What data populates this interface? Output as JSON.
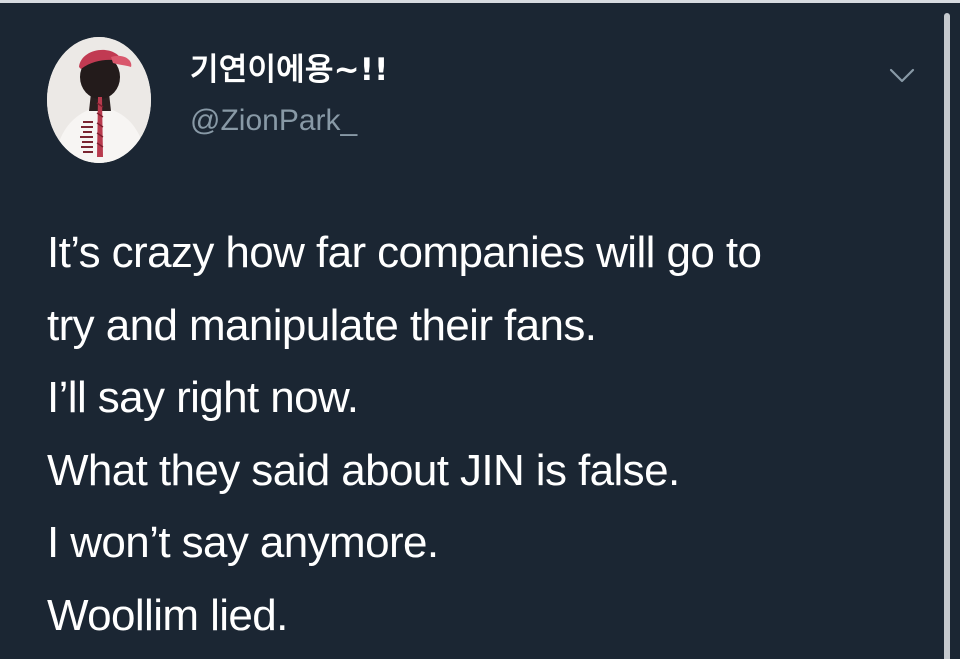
{
  "theme": {
    "background": "#1b2633",
    "text": "#ffffff",
    "secondary_text": "#8899a6",
    "scrollbar": "#c5c9ce"
  },
  "tweet": {
    "author": {
      "display_name": "기연이에용~!!",
      "handle": "@ZionPark_",
      "avatar_icon": "profile-photo"
    },
    "menu_icon": "chevron-down-icon",
    "lines": [
      "It’s crazy how far companies will go to",
      "try and manipulate their fans.",
      "I’ll say right now.",
      "What they said about JIN is false.",
      "I won’t say anymore.",
      "Woollim lied."
    ]
  }
}
